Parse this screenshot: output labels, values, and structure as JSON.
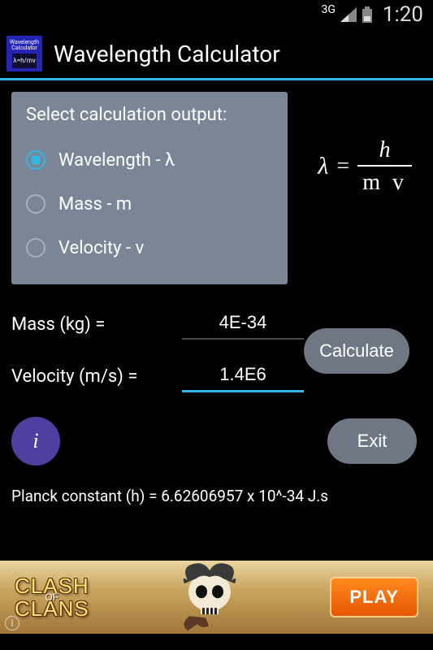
{
  "statusbar": {
    "network": "3G",
    "time": "1:20"
  },
  "header": {
    "app_name_small": "Wavelength\nCalculator",
    "title": "Wavelength Calculator"
  },
  "select": {
    "title": "Select calculation output:",
    "options": [
      {
        "label": "Wavelength - λ",
        "checked": true
      },
      {
        "label": "Mass - m",
        "checked": false
      },
      {
        "label": "Velocity - v",
        "checked": false
      }
    ]
  },
  "formula": {
    "lhs": "λ",
    "eq": "=",
    "num": "h",
    "den": "m v"
  },
  "fields": {
    "mass_label": "Mass (kg) =",
    "mass_value": "4E-34",
    "velocity_label": "Velocity (m/s) =",
    "velocity_value": "1.4E6"
  },
  "buttons": {
    "calculate": "Calculate",
    "info": "i",
    "exit": "Exit"
  },
  "planck": "Planck constant (h) = 6.62606957 x 10^-34 J.s",
  "ad": {
    "logo_line1": "CLASH",
    "logo_mid": "OF",
    "logo_line2": "CLANS",
    "play": "PLAY"
  }
}
